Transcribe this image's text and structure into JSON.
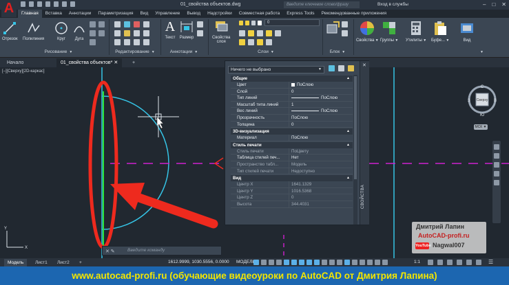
{
  "app": {
    "logo_letter": "A",
    "document_title": "01_свойства объектов.dwg",
    "search_placeholder": "Введите ключевое слово/фразу",
    "signin_label": "Вход в службы"
  },
  "ribbon_tabs": [
    {
      "label": "Главная",
      "active": true
    },
    {
      "label": "Вставка"
    },
    {
      "label": "Аннотации"
    },
    {
      "label": "Параметризация"
    },
    {
      "label": "Вид"
    },
    {
      "label": "Управление"
    },
    {
      "label": "Вывод"
    },
    {
      "label": "Надстройки"
    },
    {
      "label": "Совместная работа"
    },
    {
      "label": "Express Tools"
    },
    {
      "label": "Рекомендованные приложения"
    }
  ],
  "ribbon": {
    "draw": {
      "line": "Отрезок",
      "polyline": "Полилиния",
      "circle": "Круг",
      "arc": "Дуга",
      "group": "Рисование"
    },
    "modify": {
      "group": "Редактирование"
    },
    "annotation": {
      "text": "Текст",
      "dimension": "Размер",
      "group": "Аннотации"
    },
    "layers": {
      "properties": "Свойства",
      "properties2": "слоя",
      "layer_value": "0",
      "group": "Слои"
    },
    "block": {
      "group": "Блок"
    },
    "properties_btn": "Свойства",
    "groups_btn": "Группы",
    "utilities_btn": "Утилиты",
    "clipboard_btn": "Буфе...",
    "view_btn": "Вид"
  },
  "doc_tabs": [
    {
      "label": "Начало"
    },
    {
      "label": "01_свойства объектов*",
      "active": true
    }
  ],
  "viewport_label": "[–][Сверху][2D-каркас]",
  "properties_palette": {
    "selection": "Ничего не выбрано",
    "side_title": "СВОЙСТВА",
    "categories": [
      {
        "name": "Общие",
        "rows": [
          {
            "k": "Цвет",
            "v": "ПоСлою",
            "swatch": true
          },
          {
            "k": "Слой",
            "v": "0"
          },
          {
            "k": "Тип линий",
            "v": "ПоСлою",
            "line": true
          },
          {
            "k": "Масштаб типа линий",
            "v": "1"
          },
          {
            "k": "Вес линий",
            "v": "ПоСлою",
            "line": true
          },
          {
            "k": "Прозрачность",
            "v": "ПоСлою"
          },
          {
            "k": "Толщина",
            "v": "0"
          }
        ]
      },
      {
        "name": "3D-визуализация",
        "rows": [
          {
            "k": "Материал",
            "v": "ПоСлою"
          }
        ]
      },
      {
        "name": "Стиль печати",
        "rows": [
          {
            "k": "Стиль печати",
            "v": "ПоЦвету",
            "ro": true
          },
          {
            "k": "Таблица стилей печ...",
            "v": "Нет"
          },
          {
            "k": "Пространство табл...",
            "v": "Модель",
            "ro": true
          },
          {
            "k": "Тип стилей печати",
            "v": "Недоступно",
            "ro": true
          }
        ]
      },
      {
        "name": "Вид",
        "rows": [
          {
            "k": "Центр X",
            "v": "1641.1329",
            "ro": true
          },
          {
            "k": "Центр Y",
            "v": "1016.5368",
            "ro": true
          },
          {
            "k": "Центр Z",
            "v": "0",
            "ro": true
          },
          {
            "k": "Высота",
            "v": "344.4031",
            "ro": true
          }
        ]
      }
    ]
  },
  "viewcube": {
    "north": "С",
    "south": "Ю",
    "west": "З",
    "east": "В",
    "top": "Сверху",
    "wcs": "МСК"
  },
  "command_line": {
    "placeholder": "Введите команду"
  },
  "layout_tabs": [
    {
      "label": "Модель",
      "active": true
    },
    {
      "label": "Лист1"
    },
    {
      "label": "Лист2"
    }
  ],
  "status": {
    "coords": "1612.9999, 1030.5556, 0.0000",
    "model": "МОДЕЛЬ",
    "scale": "1:1"
  },
  "watermark": {
    "name": "Дмитрий Лапин",
    "site": "AutoCAD-profi.ru",
    "yt_label": "YouTube",
    "channel": "Nagwal007"
  },
  "banner": "www.autocad-profi.ru  (обучающие видеоуроки по AutoCAD от Дмитрия Лапина)",
  "colors": {
    "cyan": "#35c4e6",
    "green": "#2ce23a",
    "magenta": "#d020d0",
    "red_annotation": "#ee2a1e",
    "banner_text": "#f4e600",
    "banner_bg": "#1c66b0"
  }
}
